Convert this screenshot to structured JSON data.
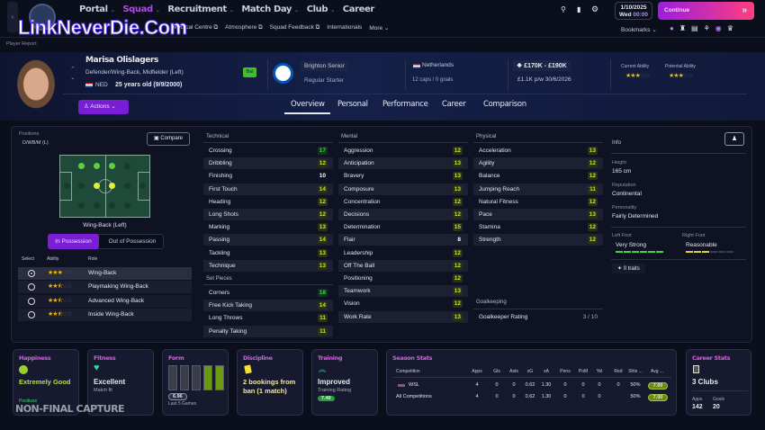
{
  "watermark": "LinkNeverDie.Com",
  "capture_label": "NON-FINAL CAPTURE",
  "nav": {
    "items": [
      {
        "label": "Portal",
        "active": false
      },
      {
        "label": "Squad",
        "active": true
      },
      {
        "label": "Recruitment",
        "active": false
      },
      {
        "label": "Match Day",
        "active": false
      },
      {
        "label": "Club",
        "active": false
      },
      {
        "label": "Career",
        "active": false
      }
    ],
    "sub": [
      "Medical Centre",
      "Atmosphere",
      "Squad Feedback",
      "Internationals"
    ],
    "more": "More",
    "bookmarks": "Bookmarks"
  },
  "date": {
    "date": "1/10/2025",
    "day": "Wed",
    "time": "00:00"
  },
  "continue_label": "Continue",
  "breadcrumb": "Player Report",
  "player": {
    "name": "Marisa Olislagers",
    "positions": "Defender/Wing-Back, Midfielder (Left)",
    "nation_code": "NED",
    "age": "25 years old (9/9/2000)",
    "role_badge": "Bal",
    "club": "Brighton Senior",
    "squad_status": "Regular Starter",
    "nationality": "Netherlands",
    "caps": "12 caps / 0 goals",
    "value": "£170K - £190K",
    "wage": "£1.1K p/w 30/6/2026",
    "current_ability_label": "Current Ability",
    "potential_ability_label": "Potential Ability",
    "current_ability_stars": 3,
    "potential_ability_stars": 3
  },
  "actions_label": "Actions",
  "tabs": [
    "Overview",
    "Personal",
    "Performance",
    "Career",
    "Comparison"
  ],
  "positions": {
    "label": "Positions",
    "value": "D/WB/M (L)",
    "compare": "Compare",
    "selected_role": "Wing-Back (Left)",
    "in_possession": "In Possession",
    "out_possession": "Out of Possession",
    "headers": [
      "Select",
      "Ability",
      "Role"
    ],
    "roles": [
      {
        "name": "Wing-Back",
        "stars": 3,
        "selected": true
      },
      {
        "name": "Playmaking Wing-Back",
        "stars": 2.5,
        "selected": false
      },
      {
        "name": "Advanced Wing-Back",
        "stars": 2.5,
        "selected": false
      },
      {
        "name": "Inside Wing-Back",
        "stars": 2.5,
        "selected": false
      }
    ]
  },
  "technical": {
    "label": "Technical",
    "attrs": [
      [
        "Crossing",
        17
      ],
      [
        "Dribbling",
        12
      ],
      [
        "Finishing",
        10
      ],
      [
        "First Touch",
        14
      ],
      [
        "Heading",
        12
      ],
      [
        "Long Shots",
        12
      ],
      [
        "Marking",
        13
      ],
      [
        "Passing",
        14
      ],
      [
        "Tackling",
        13
      ],
      [
        "Technique",
        13
      ]
    ]
  },
  "set_pieces": {
    "label": "Set Pieces",
    "attrs": [
      [
        "Corners",
        18
      ],
      [
        "Free Kick Taking",
        14
      ],
      [
        "Long Throws",
        11
      ],
      [
        "Penalty Taking",
        11
      ]
    ]
  },
  "mental": {
    "label": "Mental",
    "attrs": [
      [
        "Aggression",
        12
      ],
      [
        "Anticipation",
        13
      ],
      [
        "Bravery",
        13
      ],
      [
        "Composure",
        13
      ],
      [
        "Concentration",
        12
      ],
      [
        "Decisions",
        12
      ],
      [
        "Determination",
        15
      ],
      [
        "Flair",
        8
      ],
      [
        "Leadership",
        12
      ],
      [
        "Off The Ball",
        12
      ],
      [
        "Positioning",
        12
      ],
      [
        "Teamwork",
        13
      ],
      [
        "Vision",
        12
      ],
      [
        "Work Rate",
        13
      ]
    ]
  },
  "physical": {
    "label": "Physical",
    "attrs": [
      [
        "Acceleration",
        13
      ],
      [
        "Agility",
        12
      ],
      [
        "Balance",
        12
      ],
      [
        "Jumping Reach",
        11
      ],
      [
        "Natural Fitness",
        12
      ],
      [
        "Pace",
        13
      ],
      [
        "Stamina",
        12
      ],
      [
        "Strength",
        12
      ]
    ]
  },
  "goalkeeping": {
    "label": "Goalkeeping",
    "rating_label": "Goalkeeper Rating",
    "rating": "3 / 10"
  },
  "info": {
    "label": "Info",
    "height_label": "Height",
    "height": "165 cm",
    "reputation_label": "Reputation",
    "reputation": "Continental",
    "personality_label": "Personality",
    "personality": "Fairly Determined",
    "left_foot_label": "Left Foot",
    "left_foot": "Very Strong",
    "left_foot_level": 6,
    "right_foot_label": "Right Foot",
    "right_foot": "Reasonable",
    "right_foot_level": 3,
    "traits": "0 traits"
  },
  "cards": {
    "happiness": {
      "title": "Happiness",
      "value": "Extremely Good",
      "sub": "Positives"
    },
    "fitness": {
      "title": "Fitness",
      "value": "Excellent",
      "sub": "Match fit"
    },
    "form": {
      "title": "Form",
      "rating": "6.96",
      "sub": "Last 5 Games",
      "games": [
        "none",
        "none",
        "none",
        "good",
        "good"
      ]
    },
    "discipline": {
      "title": "Discipline",
      "value": "2 bookings from ban (1 match)"
    },
    "training": {
      "title": "Training",
      "value": "Improved",
      "sub": "Training Rating",
      "rating": "7.40"
    },
    "season": {
      "title": "Season Stats",
      "headers": [
        "Competition",
        "Apps",
        "Gls",
        "Asts",
        "xG",
        "xA",
        "Pens",
        "PoM",
        "Yel",
        "Red",
        "Shts ...",
        "Avg ..."
      ],
      "rows": [
        [
          "WSL",
          "4",
          "0",
          "0",
          "0.62",
          "1.30",
          "0",
          "0",
          "0",
          "0",
          "50%",
          "7.00"
        ],
        [
          "All Competitions",
          "4",
          "0",
          "0",
          "0.62",
          "1.30",
          "0",
          "0",
          "0",
          "",
          "50%",
          "7.00"
        ]
      ]
    },
    "career": {
      "title": "Career Stats",
      "value": "3 Clubs",
      "apps_label": "Apps",
      "apps": "142",
      "goals_label": "Goals",
      "goals": "20"
    }
  },
  "colors": {
    "accent": "#8a2be2",
    "continue_start": "#9b1ee0",
    "continue_end": "#ff3d7f",
    "attr_high": "#39d353",
    "attr_good": "#c9e53a",
    "card_title": "#d660e0"
  }
}
